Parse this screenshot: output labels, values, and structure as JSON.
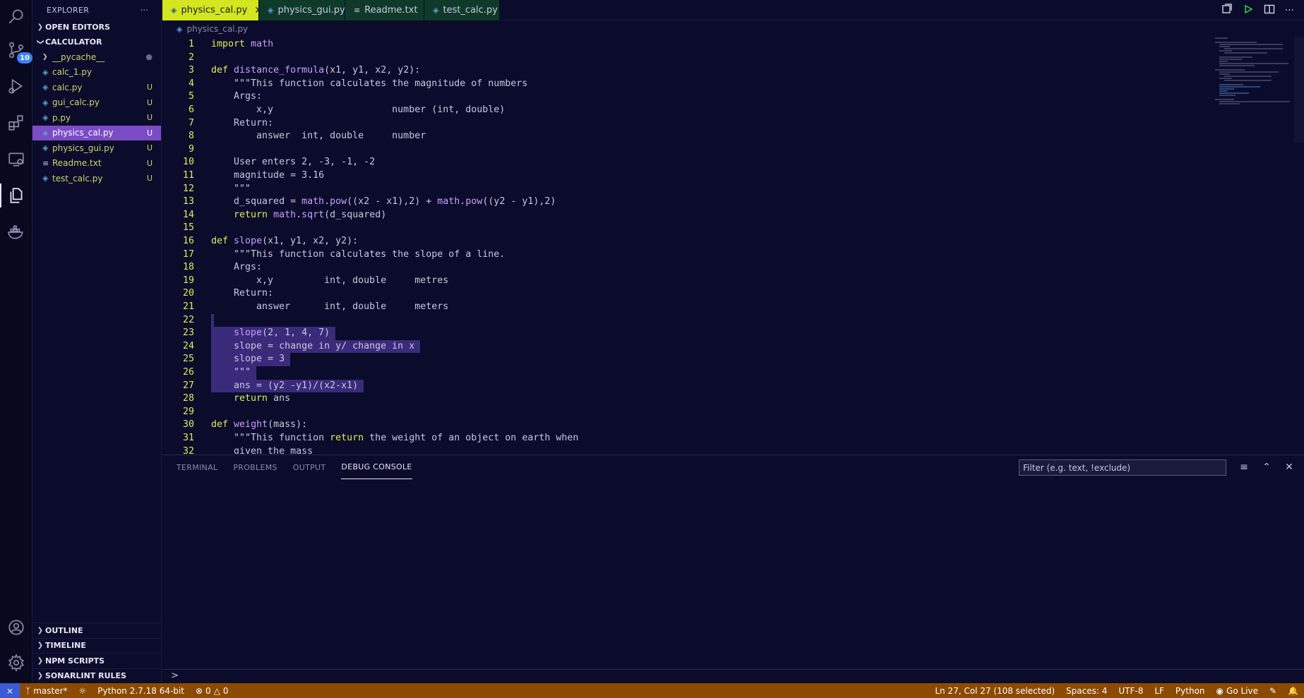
{
  "activity_bar": {
    "scm_badge": "10"
  },
  "sidebar": {
    "title": "EXPLORER",
    "more": "···",
    "open_editors": "OPEN EDITORS",
    "folder": "CALCULATOR",
    "files": [
      {
        "name": "__pycache__",
        "status": "●",
        "type": "folder"
      },
      {
        "name": "calc_1.py",
        "status": "",
        "type": "python"
      },
      {
        "name": "calc.py",
        "status": "U",
        "type": "python"
      },
      {
        "name": "gui_calc.py",
        "status": "U",
        "type": "python"
      },
      {
        "name": "p.py",
        "status": "U",
        "type": "python"
      },
      {
        "name": "physics_cal.py",
        "status": "U",
        "type": "python",
        "active": true
      },
      {
        "name": "physics_gui.py",
        "status": "U",
        "type": "python"
      },
      {
        "name": "Readme.txt",
        "status": "U",
        "type": "text"
      },
      {
        "name": "test_calc.py",
        "status": "U",
        "type": "python"
      }
    ],
    "bottom_sections": [
      "OUTLINE",
      "TIMELINE",
      "NPM SCRIPTS",
      "SONARLINT RULES"
    ]
  },
  "tabs": [
    {
      "label": "physics_cal.py",
      "active": true
    },
    {
      "label": "physics_gui.py"
    },
    {
      "label": "Readme.txt"
    },
    {
      "label": "test_calc.py"
    }
  ],
  "breadcrumb": "physics_cal.py",
  "editor": {
    "lines": [
      "import math",
      "",
      "def distance_formula(x1, y1, x2, y2):",
      "    \"\"\"This function calculates the magnitude of numbers",
      "    Args:",
      "        x,y                     number (int, double)",
      "    Return:",
      "        answer  int, double     number",
      "",
      "    User enters 2, -3, -1, -2",
      "    magnitude = 3.16",
      "    \"\"\"",
      "    d_squared = math.pow((x2 - x1),2) + math.pow((y2 - y1),2)",
      "    return math.sqrt(d_squared)",
      "",
      "def slope(x1, y1, x2, y2):",
      "    \"\"\"This function calculates the slope of a line.",
      "    Args:",
      "        x,y         int, double     metres",
      "    Return:",
      "        answer      int, double     meters",
      "",
      "    slope(2, 1, 4, 7)",
      "    slope = change in y/ change in x",
      "    slope = 3",
      "    \"\"\"",
      "    ans = (y2 -y1)/(x2-x1)",
      "    return ans",
      "",
      "def weight(mass):",
      "    \"\"\"This function return the weight of an object on earth when",
      "    given the mass"
    ],
    "selected_lines": [
      22,
      23,
      24,
      25,
      26,
      27
    ]
  },
  "panel": {
    "tabs": [
      "TERMINAL",
      "PROBLEMS",
      "OUTPUT",
      "DEBUG CONSOLE"
    ],
    "active_tab": "DEBUG CONSOLE",
    "filter_placeholder": "Filter (e.g. text, !exclude)",
    "prompt": ">"
  },
  "status_bar": {
    "branch": "master*",
    "interpreter": "Python 2.7.18 64-bit",
    "errors": "0",
    "warnings": "0",
    "cursor": "Ln 27, Col 27 (108 selected)",
    "spaces": "Spaces: 4",
    "encoding": "UTF-8",
    "eol": "LF",
    "language": "Python",
    "golive": "Go Live"
  }
}
